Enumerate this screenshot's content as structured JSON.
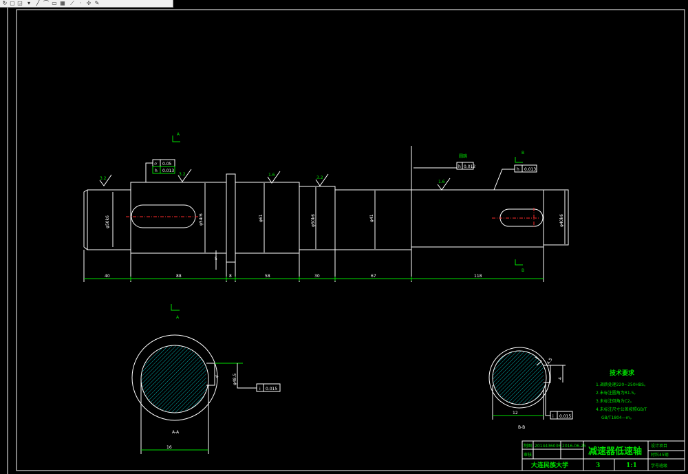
{
  "toolbar": {
    "icons": [
      {
        "name": "redo-icon",
        "glyph": "↻"
      },
      {
        "name": "layer-icon",
        "glyph": "▢"
      },
      {
        "name": "measure-icon",
        "glyph": "◲"
      },
      {
        "name": "dropdown-icon",
        "glyph": "▾"
      },
      {
        "name": "line-icon",
        "glyph": "╱"
      },
      {
        "name": "arc-icon",
        "glyph": "⌒"
      },
      {
        "name": "rectangle-icon",
        "glyph": "▭"
      },
      {
        "name": "hatch-icon",
        "glyph": "▦"
      },
      {
        "name": "polyline-icon",
        "glyph": "⟋"
      },
      {
        "name": "point-icon",
        "glyph": "·"
      },
      {
        "name": "move-icon",
        "glyph": "✢"
      },
      {
        "name": "paint-icon",
        "glyph": "✎"
      }
    ]
  },
  "colors": {
    "background": "#000000",
    "lines": "#ffffff",
    "annotation": "#00e000",
    "centerline": "#ff2a2a",
    "hatch": "#00d8d8"
  },
  "section_markers": {
    "a1": "A",
    "a2": "A",
    "b1": "B",
    "b2": "B",
    "a3": "A"
  },
  "roughness": {
    "r1": "3.2",
    "r2": "3.2",
    "r3": "1.6",
    "r4": "3.2",
    "r5": "1.6",
    "r6": "1.6"
  },
  "tolerances": {
    "fc1_sym": "⌭",
    "fc1_val": "0.05",
    "fc2_sym": "h",
    "fc2_val": "0.013",
    "fc3_label": "圆跳",
    "fc3_sym": "h",
    "fc3_val": "0.012",
    "fc4_sym": "h",
    "fc4_val": "0.013",
    "fc5_sym": "i",
    "fc5_val": "0.015",
    "fc6_sym": "i",
    "fc6_val": "0.015"
  },
  "diameters": {
    "d1": "φ50k6",
    "d2": "φ54r6",
    "d3": "φ61",
    "d4": "φ50k6",
    "d5": "φ41",
    "d6": "φ40k6"
  },
  "small_dims": {
    "shoulder_height": "5",
    "sec_a_depth": "φ48.5",
    "sec_a_angle": "4",
    "sec_b_depth": "4",
    "sec_b_angle": "4.5"
  },
  "dimensions": {
    "l1": "40",
    "l2": "88",
    "l3": "8",
    "l4": "58",
    "l5": "30",
    "l6": "67",
    "l7": "118"
  },
  "sections": {
    "a_label": "A-A",
    "a_width": "16",
    "b_label": "B-B",
    "b_width": "12"
  },
  "tech_req": {
    "title": "技术要求",
    "items": [
      "1.调质处理220~250HBS。",
      "2.未标注圆角为R1.5。",
      "3.未标注倒角为C2。",
      "4.未标注尺寸公差按照GB/T",
      "GB/T1804—m。"
    ]
  },
  "title_block": {
    "drawn_label": "制图",
    "drawn_name": "2014436036",
    "drawn_date": "2016-06-25",
    "check_label": "审核",
    "title": "减速器低速轴",
    "school": "大连民族大学",
    "qty": "3",
    "scale": "1:1",
    "code1": "设计项目",
    "code2": "材料45钢",
    "code3": "学号班级"
  }
}
